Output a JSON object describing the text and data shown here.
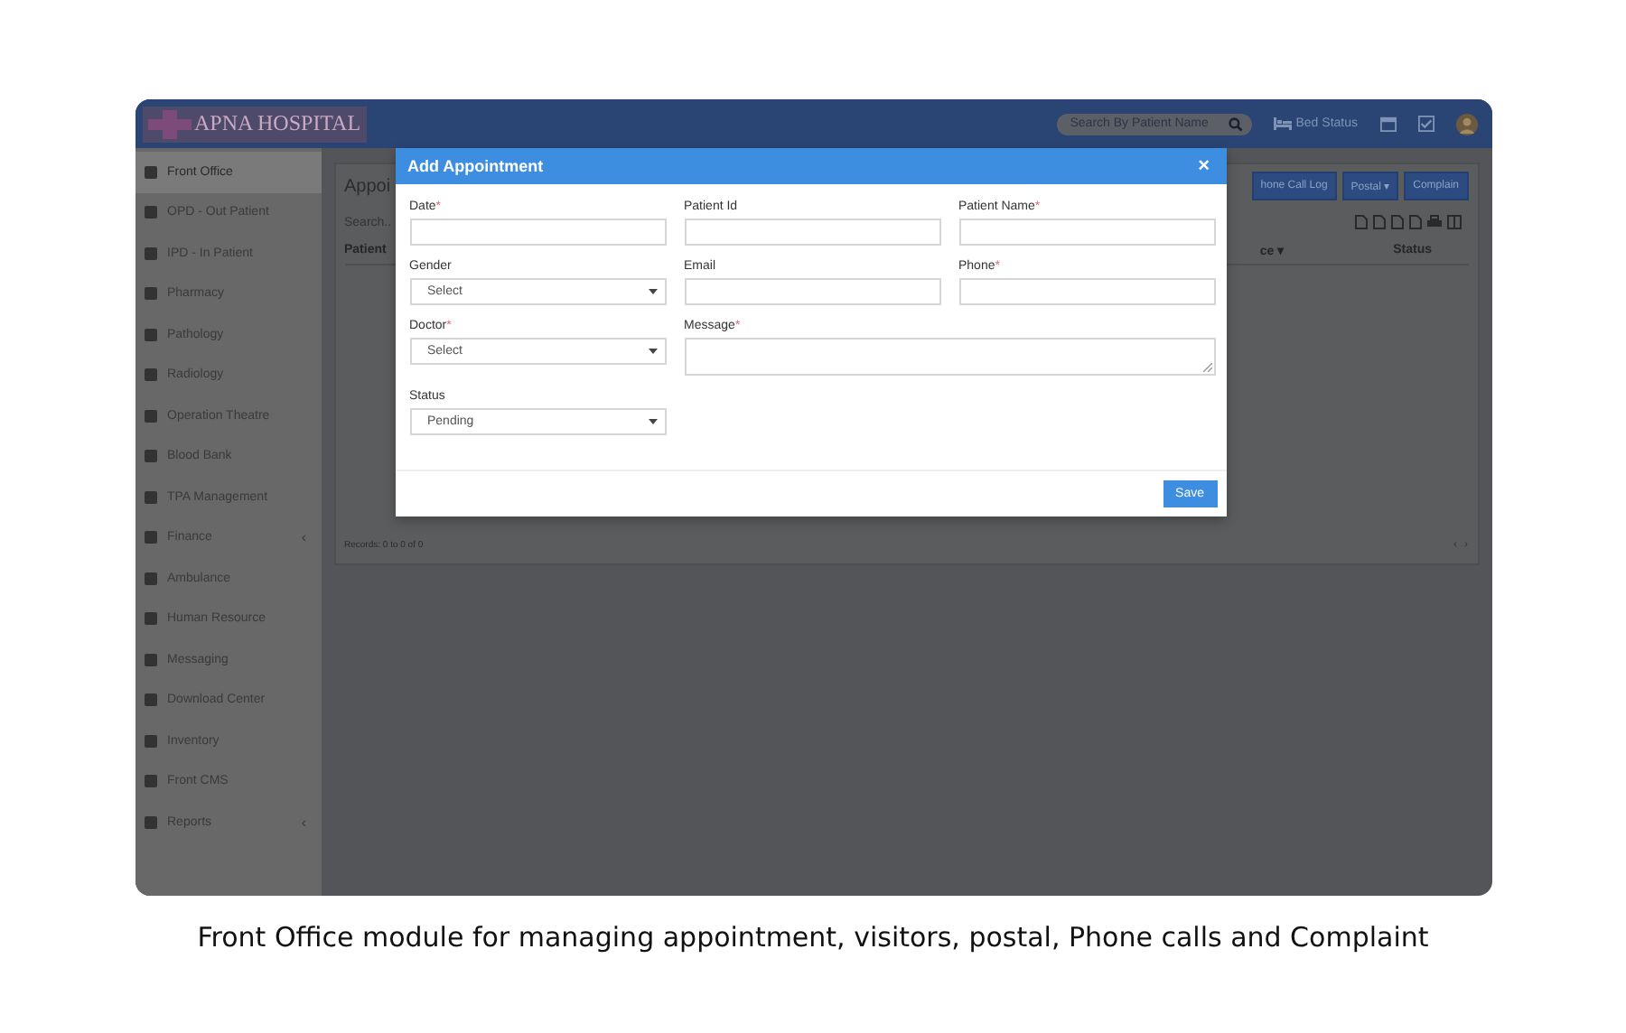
{
  "header": {
    "logo": "APNA HOSPITAL",
    "search": {
      "placeholder": "Search By Patient Name"
    },
    "bed_status": "Bed Status"
  },
  "sidebar": {
    "items": [
      {
        "label": "Front Office",
        "selected": true
      },
      {
        "label": "OPD - Out Patient",
        "selected": false
      },
      {
        "label": "IPD - In Patient",
        "selected": false
      },
      {
        "label": "Pharmacy",
        "selected": false
      },
      {
        "label": "Pathology",
        "selected": false
      },
      {
        "label": "Radiology",
        "selected": false
      },
      {
        "label": "Operation Theatre",
        "selected": false
      },
      {
        "label": "Blood Bank",
        "selected": false
      },
      {
        "label": "TPA Management",
        "selected": false
      },
      {
        "label": "Finance",
        "selected": false,
        "arrow": "‹"
      },
      {
        "label": "Ambulance",
        "selected": false
      },
      {
        "label": "Human Resource",
        "selected": false
      },
      {
        "label": "Messaging",
        "selected": false
      },
      {
        "label": "Download Center",
        "selected": false
      },
      {
        "label": "Inventory",
        "selected": false
      },
      {
        "label": "Front CMS",
        "selected": false
      },
      {
        "label": "Reports",
        "selected": false,
        "arrow": "‹"
      }
    ]
  },
  "panel": {
    "title": "Appoi",
    "buttons": [
      "hone Call Log",
      "Postal ▾",
      "Complain"
    ],
    "search": "Search..",
    "columns": [
      "Patient",
      "ce ▾",
      "Status"
    ],
    "records": "Records: 0 to 0 of 0",
    "pager": [
      "‹",
      "›"
    ]
  },
  "modal": {
    "title": "Add Appointment",
    "close": "×",
    "fields": [
      {
        "label": "Date",
        "required_mark": "*",
        "kind": "text"
      },
      {
        "label": "Patient Id",
        "kind": "text"
      },
      {
        "label": "Patient Name",
        "required_mark": "*",
        "kind": "text"
      },
      {
        "label": "Gender",
        "kind": "select",
        "value": "Select"
      },
      {
        "label": "Email",
        "kind": "text"
      },
      {
        "label": "Phone",
        "required_mark": "*",
        "kind": "text"
      },
      {
        "label": "Doctor",
        "required_mark": "*",
        "kind": "select",
        "value": "Select"
      },
      {
        "label": "Message",
        "required_mark": "*",
        "kind": "textarea"
      },
      {
        "label": "Status",
        "kind": "select",
        "value": "Pending"
      }
    ],
    "save": "Save"
  },
  "caption": "Front Office module for managing appointment, visitors, postal, Phone calls and Complaint"
}
